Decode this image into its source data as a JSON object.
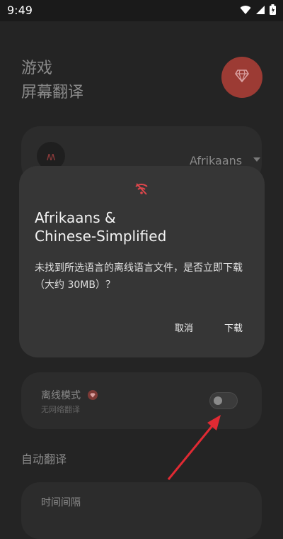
{
  "status_bar": {
    "time": "9:49"
  },
  "page": {
    "title_line1": "游戏",
    "title_line2": "屏幕翻译"
  },
  "language_card": {
    "selected_language": "Afrikaans"
  },
  "offline_card": {
    "title": "离线模式",
    "subtitle": "无网络翻译",
    "toggle_on": false
  },
  "auto_section": {
    "title": "自动翻译",
    "item_label": "时间间隔"
  },
  "dialog": {
    "title": "Afrikaans &\nChinese-Simplified",
    "message": "未找到所选语言的离线语言文件，是否立即下载（大约 30MB）？",
    "cancel_label": "取消",
    "download_label": "下载"
  },
  "colors": {
    "accent_red": "#e0474c",
    "gem_button": "#9c3b34",
    "dialog_bg": "#363636"
  },
  "icons": [
    "wifi-icon",
    "signal-icon",
    "battery-icon",
    "gem-icon",
    "wifi-off-icon",
    "dropdown-arrow-icon"
  ]
}
